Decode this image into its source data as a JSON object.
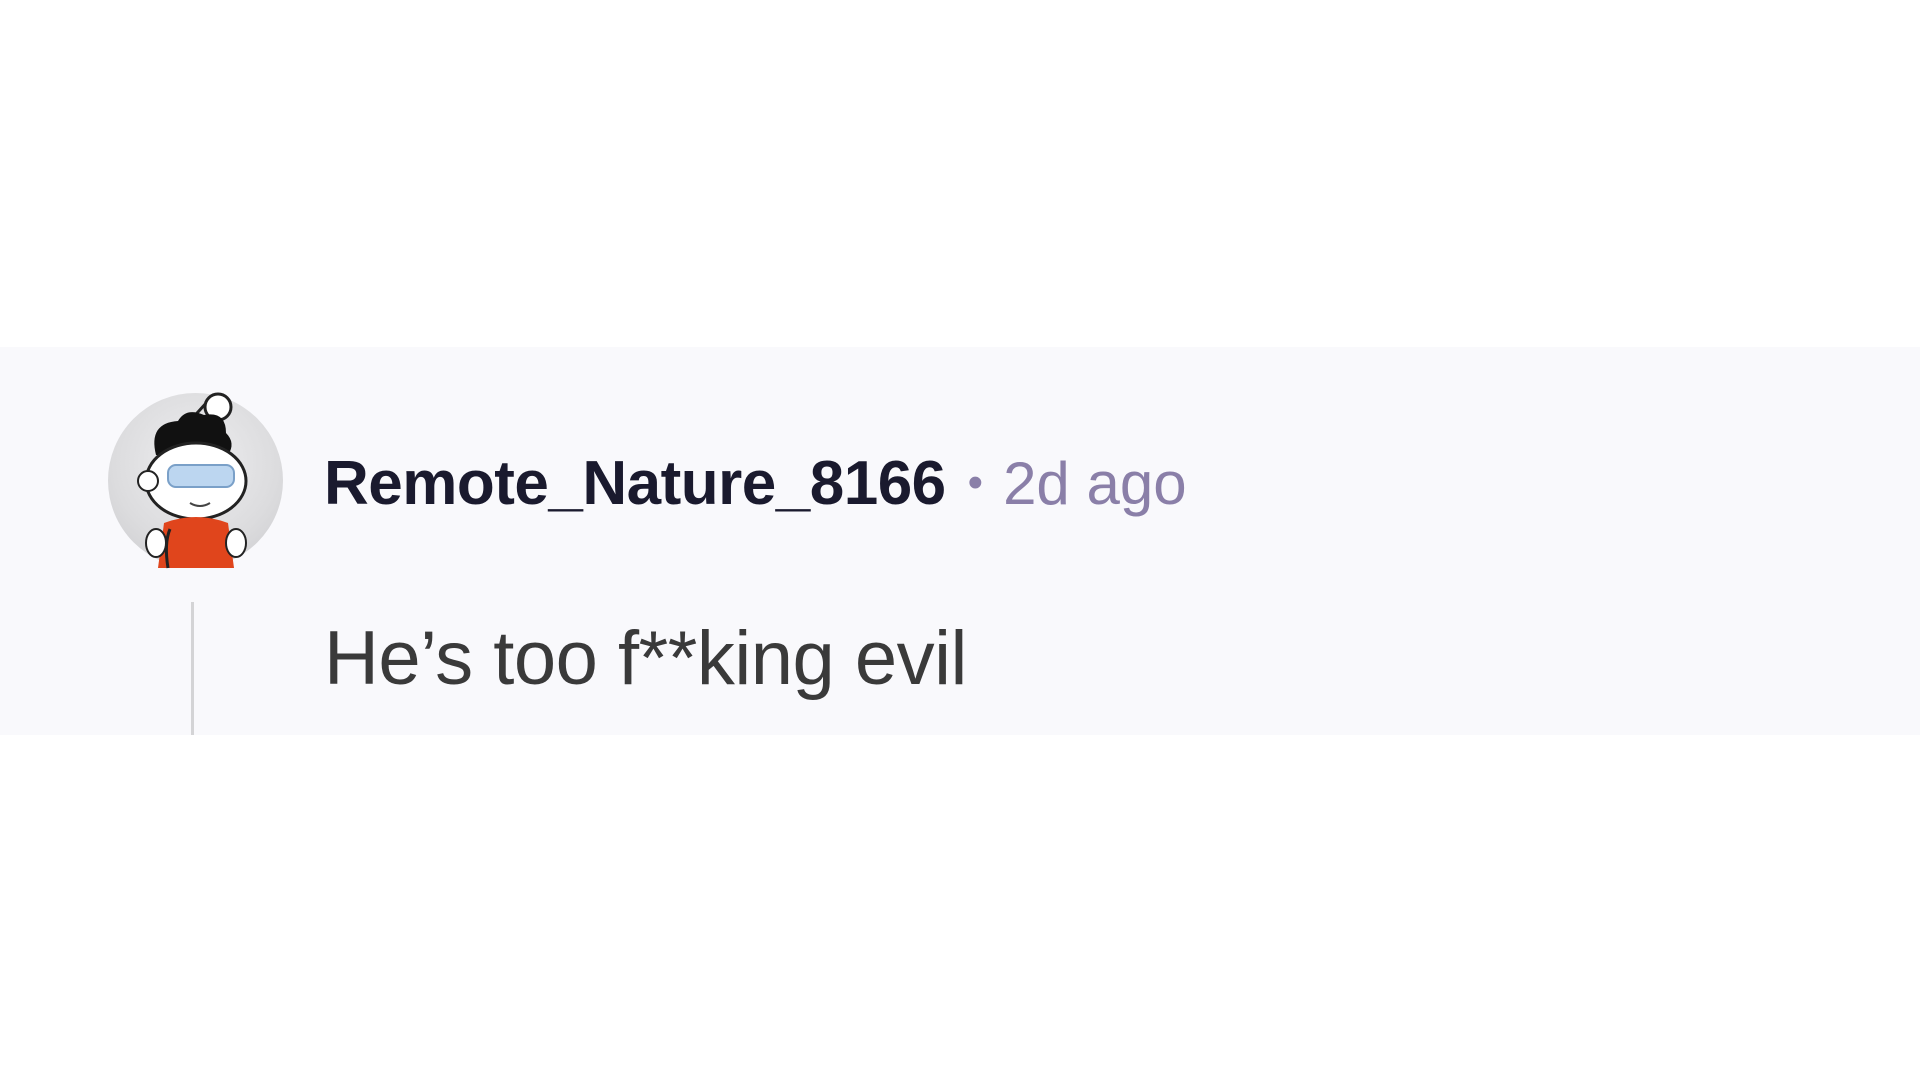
{
  "comment": {
    "avatar_icon": "reddit-snoo-avatar-icon",
    "username": "Remote_Nature_8166",
    "separator": "•",
    "timestamp": "2d ago",
    "body": "He’s too f**king evil"
  },
  "colors": {
    "card_background": "#f9f9fc",
    "username": "#1a1a2e",
    "timestamp": "#8a7fa8",
    "body_text": "#3a3a3a",
    "thread_line": "#d4d4d6"
  }
}
